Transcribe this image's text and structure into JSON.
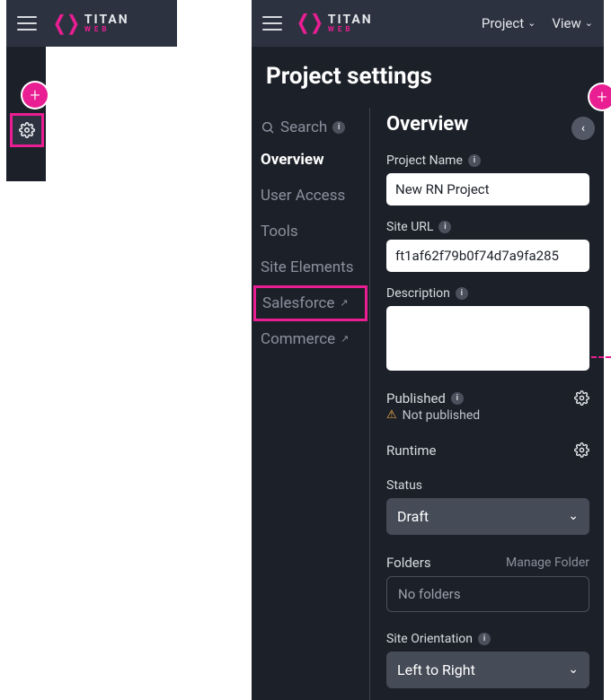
{
  "brand": {
    "title": "TITAN",
    "sub": "WEB"
  },
  "top_menu": {
    "project": "Project",
    "view": "View"
  },
  "page_title": "Project settings",
  "side": {
    "search": "Search",
    "items": [
      {
        "label": "Overview"
      },
      {
        "label": "User Access"
      },
      {
        "label": "Tools"
      },
      {
        "label": "Site Elements"
      },
      {
        "label": "Salesforce"
      },
      {
        "label": "Commerce"
      }
    ]
  },
  "form": {
    "section": "Overview",
    "project_name_label": "Project Name",
    "project_name_value": "New RN Project",
    "site_url_label": "Site URL",
    "site_url_value": "ft1af62f79b0f74d7a9fa285",
    "description_label": "Description",
    "description_value": "",
    "published_label": "Published",
    "published_status": "Not published",
    "runtime_label": "Runtime",
    "status_label": "Status",
    "status_value": "Draft",
    "folders_label": "Folders",
    "manage_folder": "Manage Folder",
    "no_folders": "No folders",
    "orientation_label": "Site Orientation",
    "orientation_value": "Left to Right"
  }
}
